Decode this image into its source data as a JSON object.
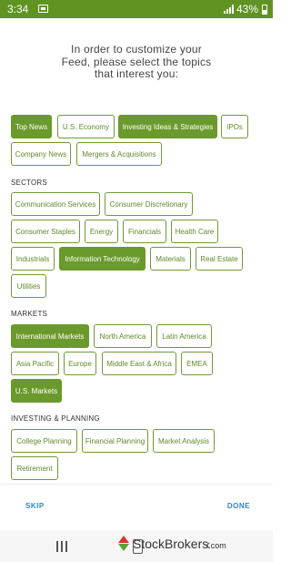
{
  "status_bar": {
    "time": "3:34",
    "battery": "43%"
  },
  "intro": {
    "line1": "In order to customize your",
    "line2": "Feed, please select the topics",
    "line3": "that interest you:"
  },
  "topics": {
    "general": [
      {
        "label": "Top News",
        "selected": true
      },
      {
        "label": "U.S. Economy",
        "selected": false
      },
      {
        "label": "Investing Ideas & Strategies",
        "selected": true
      },
      {
        "label": "IPOs",
        "selected": false
      },
      {
        "label": "Company News",
        "selected": false
      },
      {
        "label": "Mergers & Acquisitions",
        "selected": false
      }
    ],
    "sectors_label": "SECTORS",
    "sectors": [
      {
        "label": "Communication Services",
        "selected": false
      },
      {
        "label": "Consumer Discretionary",
        "selected": false
      },
      {
        "label": "Consumer Staples",
        "selected": false
      },
      {
        "label": "Energy",
        "selected": false
      },
      {
        "label": "Financials",
        "selected": false
      },
      {
        "label": "Health Care",
        "selected": false
      },
      {
        "label": "Industrials",
        "selected": false
      },
      {
        "label": "Information Technology",
        "selected": true
      },
      {
        "label": "Materials",
        "selected": false
      },
      {
        "label": "Real Estate",
        "selected": false
      },
      {
        "label": "Utilities",
        "selected": false
      }
    ],
    "markets_label": "MARKETS",
    "markets": [
      {
        "label": "International Markets",
        "selected": true
      },
      {
        "label": "North America",
        "selected": false
      },
      {
        "label": "Latin America",
        "selected": false
      },
      {
        "label": "Asia Pacific",
        "selected": false
      },
      {
        "label": "Europe",
        "selected": false
      },
      {
        "label": "Middle East & Africa",
        "selected": false
      },
      {
        "label": "EMEA",
        "selected": false
      },
      {
        "label": "U.S. Markets",
        "selected": true
      }
    ],
    "planning_label": "INVESTING & PLANNING",
    "planning": [
      {
        "label": "College Planning",
        "selected": false
      },
      {
        "label": "Financial Planning",
        "selected": false
      },
      {
        "label": "Market Analysis",
        "selected": false
      },
      {
        "label": "Retirement",
        "selected": false
      }
    ]
  },
  "footer": {
    "skip": "SKIP",
    "done": "DONE"
  },
  "watermark": {
    "text": "StockBrokers",
    "suffix": ".com"
  }
}
